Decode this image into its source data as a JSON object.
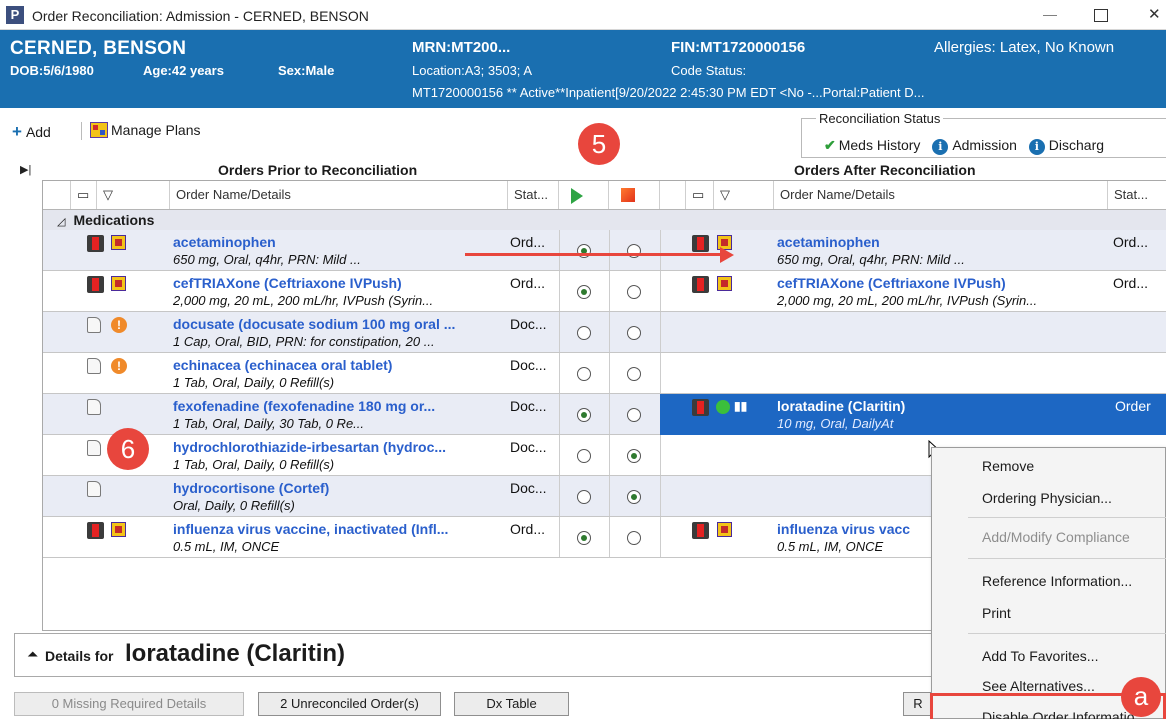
{
  "window": {
    "app_letter": "P",
    "title": "Order Reconciliation: Admission - CERNED, BENSON"
  },
  "banner": {
    "name": "CERNED, BENSON",
    "dob": "DOB:5/6/1980",
    "age": "Age:42 years",
    "sex": "Sex:Male",
    "mrn": "MRN:MT200...",
    "location": "Location:A3; 3503; A",
    "fin": "FIN:MT1720000156",
    "code_status": "Code Status:",
    "allergies": "Allergies: Latex, No Known",
    "encounter": "MT1720000156 ** Active**Inpatient[9/20/2022 2:45:30 PM EDT <No -...Portal:Patient D..."
  },
  "toolbar": {
    "add_label": "Add",
    "manage_plans_label": "Manage Plans"
  },
  "recon_status": {
    "title": "Reconciliation Status",
    "meds_history": "Meds History",
    "admission": "Admission",
    "discharge": "Discharg"
  },
  "badges": {
    "five": "5",
    "six": "6",
    "a": "a"
  },
  "sections": {
    "prior": "Orders Prior to Reconciliation",
    "after": "Orders After Reconciliation"
  },
  "columns": {
    "order_name": "Order Name/Details",
    "status": "Stat..."
  },
  "category": "Medications",
  "orders": [
    {
      "name": "acetaminophen",
      "details": "650 mg, Oral, q4hr, PRN: Mild ...",
      "status": "Ord...",
      "continue": true,
      "stop": false,
      "after_name": "acetaminophen",
      "after_details": "650 mg, Oral, q4hr, PRN: Mild ...",
      "after_status": "Ord..."
    },
    {
      "name": "cefTRIAXone (Ceftriaxone IVPush)",
      "details": "2,000 mg, 20 mL, 200 mL/hr, IVPush (Syrin...",
      "status": "Ord...",
      "continue": true,
      "stop": false,
      "after_name": "cefTRIAXone (Ceftriaxone IVPush)",
      "after_details": "2,000 mg, 20 mL, 200 mL/hr, IVPush (Syrin...",
      "after_status": "Ord..."
    },
    {
      "name": "docusate (docusate sodium 100 mg oral ...",
      "details": "1 Cap, Oral, BID, PRN: for constipation, 20 ...",
      "status": "Doc...",
      "continue": false,
      "stop": false
    },
    {
      "name": "echinacea (echinacea oral tablet)",
      "details": "1 Tab, Oral, Daily, 0 Refill(s)",
      "status": "Doc...",
      "continue": false,
      "stop": false
    },
    {
      "name": "fexofenadine (fexofenadine 180 mg or...",
      "details": "1 Tab, Oral, Daily, 30 Tab, 0 Re...",
      "status": "Doc...",
      "continue": true,
      "stop": false,
      "after_name": "loratadine (Claritin)",
      "after_details": "10 mg, Oral, DailyAt",
      "after_status": "Order"
    },
    {
      "name": "hydrochlorothiazide-irbesartan (hydroc...",
      "details": "1 Tab, Oral, Daily, 0 Refill(s)",
      "status": "Doc...",
      "continue": false,
      "stop": true
    },
    {
      "name": "hydrocortisone (Cortef)",
      "details": "Oral, Daily, 0 Refill(s)",
      "status": "Doc...",
      "continue": false,
      "stop": true
    },
    {
      "name": "influenza virus vaccine, inactivated (Infl...",
      "details": "0.5 mL, IM, ONCE",
      "status": "Ord...",
      "continue": true,
      "stop": false,
      "after_name": "influenza virus vacc",
      "after_details": "0.5 mL, IM, ONCE",
      "after_status": ""
    }
  ],
  "details_bar": {
    "label": "Details for",
    "name": "loratadine (Claritin)"
  },
  "bottom_buttons": {
    "missing": "0 Missing Required Details",
    "unreconciled": "2 Unreconciled Order(s)",
    "dx": "Dx Table",
    "r": "R"
  },
  "context_menu": {
    "items": [
      {
        "label": "Remove",
        "disabled": false
      },
      {
        "label": "Ordering Physician...",
        "disabled": false
      },
      {
        "label": "Add/Modify Compliance",
        "disabled": true
      },
      {
        "label": "Reference Information...",
        "disabled": false
      },
      {
        "label": "Print",
        "disabled": false
      },
      {
        "label": "Add To Favorites...",
        "disabled": false
      },
      {
        "label": "See Alternatives...",
        "disabled": false
      },
      {
        "label": "Disable Order Informatio",
        "disabled": false
      }
    ]
  },
  "colors": {
    "banner": "#1a6fb0",
    "accent_red": "#e8463d",
    "link_blue": "#2a5fcc",
    "selected_row": "#1d67c3"
  }
}
